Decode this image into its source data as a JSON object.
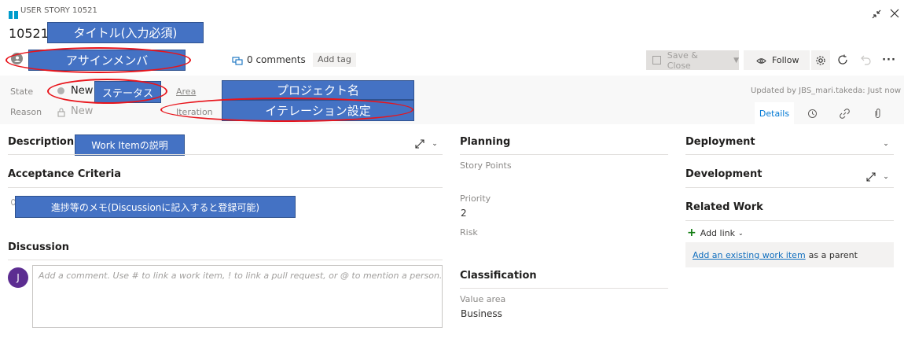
{
  "header": {
    "type_label": "USER STORY 10521",
    "id": "10521",
    "comments": "0 comments",
    "add_tag": "Add tag",
    "save_close": "Save & Close",
    "follow": "Follow"
  },
  "fields": {
    "state_label": "State",
    "state_value": "New",
    "reason_label": "Reason",
    "reason_value": "New",
    "area_label": "Area",
    "iteration_label": "Iteration",
    "updated_by": "Updated by JBS_mari.takeda: Just now",
    "details_tab": "Details"
  },
  "left": {
    "description": "Description",
    "acceptance": "Acceptance Criteria",
    "discussion": "Discussion",
    "avatar_letter": "J",
    "comment_placeholder": "Add a comment. Use # to link a work item, ! to link a pull request, or @ to mention a person."
  },
  "middle": {
    "planning": "Planning",
    "story_points": "Story Points",
    "priority_label": "Priority",
    "priority_value": "2",
    "risk": "Risk",
    "classification": "Classification",
    "value_area_label": "Value area",
    "value_area_value": "Business"
  },
  "right": {
    "deployment": "Deployment",
    "development": "Development",
    "related_work": "Related Work",
    "add_link": "Add link",
    "existing_link": "Add an existing work item",
    "as_parent": "as a parent"
  },
  "annotations": {
    "title_required": "タイトル(入力必須)",
    "assign_member": "アサインメンバ",
    "status": "ステータス",
    "project_name": "プロジェクト名",
    "iteration_setting": "イテレーション設定",
    "work_item_desc": "Work Itemの説明",
    "progress_memo": "進捗等のメモ(Discussionに記入すると登録可能)"
  },
  "colors": {
    "accent": "#0078d4",
    "callout": "#4472c4",
    "ellipse": "#e8141b",
    "avatar": "#5c2d91"
  }
}
